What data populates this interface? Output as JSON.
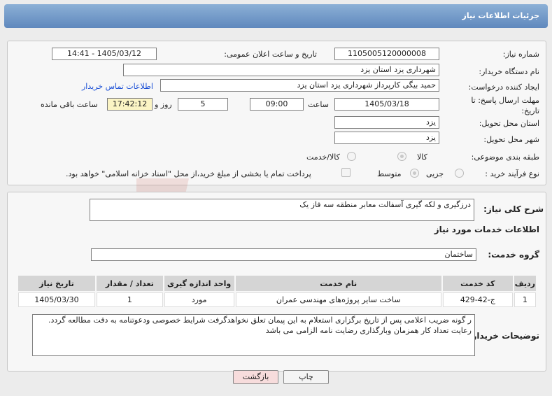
{
  "header": {
    "title": "جزئیات اطلاعات نیاز"
  },
  "form": {
    "need_number_label": "شماره نیاز:",
    "need_number": "1105005120000008",
    "announce_label": "تاریخ و ساعت اعلان عمومی:",
    "announce_value": "1405/03/12 - 14:41",
    "buyer_label": "نام دستگاه خریدار:",
    "buyer_value": "شهرداری یزد استان یزد",
    "creator_label": "ایجاد کننده درخواست:",
    "creator_value": "حمید بیگی کارپرداز شهرداری یزد استان یزد",
    "contact_link": "اطلاعات تماس خریدار",
    "deadline_label": "مهلت ارسال پاسخ: تا تاریخ:",
    "deadline_date": "1405/03/18",
    "time_label": "ساعت",
    "deadline_time": "09:00",
    "days_value": "5",
    "days_label": "روز و",
    "remaining_time": "17:42:12",
    "remaining_label": "ساعت باقی مانده",
    "province_label": "استان محل تحویل:",
    "province_value": "یزد",
    "city_label": "شهر محل تحویل:",
    "city_value": "یزد",
    "category_label": "طبقه بندی موضوعی:",
    "category_options": [
      "کالا",
      "کالا/خدمت"
    ],
    "process_label": "نوع فرآیند خرید :",
    "process_options": [
      "جزیی",
      "متوسط"
    ],
    "payment_note": "پرداخت تمام یا بخشی از مبلغ خرید،از محل \"اسناد خزانه اسلامی\" خواهد بود."
  },
  "need": {
    "summary_label": "شرح کلی نیاز:",
    "summary_value": "درزگیری و لکه گیری آسفالت معابر منطقه سه فاز یک",
    "services_title": "اطلاعات خدمات مورد نیاز",
    "group_label": "گروه خدمت:",
    "group_value": "ساختمان"
  },
  "table": {
    "headers": [
      "ردیف",
      "کد خدمت",
      "نام خدمت",
      "واحد اندازه گیری",
      "تعداد / مقدار",
      "تاریخ نیاز"
    ],
    "rows": [
      [
        "1",
        "ج-42-429",
        "ساخت سایر پروژه‌های مهندسی عمران",
        "مورد",
        "1",
        "1405/03/30"
      ]
    ]
  },
  "notes": {
    "label": "توضیحات خریدار:",
    "text": "ر گونه ضریب اعلامی پس از تاریخ برگزاری استعلام به این پیمان تعلق نخواهدگرفت شرایط خصوصی ودعوتنامه به دقت مطالعه گردد. رعایت تعداد کار همزمان وبارگذاری رضایت نامه الزامی می باشد"
  },
  "buttons": {
    "print": "چاپ",
    "back": "بازگشت"
  },
  "watermark": {
    "text": "AriaTender.net"
  }
}
